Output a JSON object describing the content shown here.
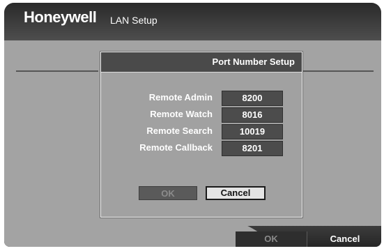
{
  "header": {
    "logo": "Honeywell",
    "title": "LAN Setup"
  },
  "dialog": {
    "title": "Port Number Setup",
    "ports": [
      {
        "label": "Remote Admin",
        "value": "8200"
      },
      {
        "label": "Remote Watch",
        "value": "8016"
      },
      {
        "label": "Remote Search",
        "value": "10019"
      },
      {
        "label": "Remote Callback",
        "value": "8201"
      }
    ],
    "ok_label": "OK",
    "cancel_label": "Cancel"
  },
  "footer": {
    "ok_label": "OK",
    "cancel_label": "Cancel"
  }
}
